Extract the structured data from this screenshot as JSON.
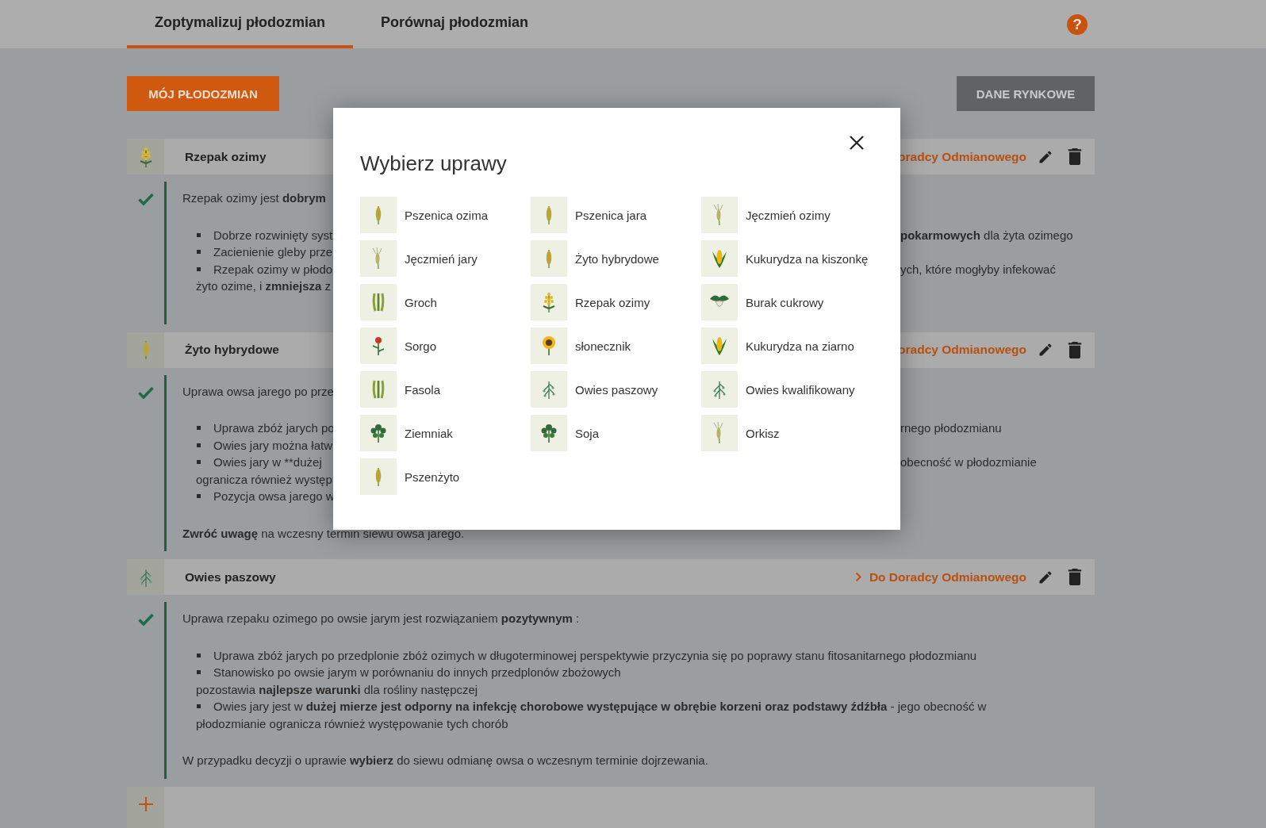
{
  "tabs": [
    {
      "label": "Zoptymalizuj płodozmian",
      "selected": true
    },
    {
      "label": "Porównaj płodozmian",
      "selected": false
    }
  ],
  "help_icon": "?",
  "buttons": {
    "primary": "MÓJ PŁODOZMIAN",
    "secondary": "DANE RYNKOWE"
  },
  "sections": [
    {
      "title": "Rzepak ozimy",
      "kind": "rapeseed",
      "link": "oradcy Odmianowego",
      "positive": true,
      "lines": [
        {
          "kind": "para",
          "left": "Rzepak ozimy jest **dobrym**"
        },
        {
          "kind": "gap"
        },
        {
          "kind": "bullet",
          "left": "Dobrze rozwinięty syst",
          "right": "**pokarmowych** dla żyta ozimego"
        },
        {
          "kind": "bullet",
          "left": "Zacienienie gleby prze"
        },
        {
          "kind": "bullet",
          "left": "Rzepak ozimy w płodo",
          "right": "ych, które mogłyby infekować"
        },
        {
          "kind": "cont",
          "left": "żyto ozime, i **zmniejsza** z"
        },
        {
          "kind": "gap"
        }
      ]
    },
    {
      "title": "Żyto hybrydowe",
      "kind": "grain",
      "link": "oradcy Odmianowego",
      "positive": true,
      "lines": [
        {
          "kind": "para",
          "left": "Uprawa owsa jarego po prze"
        },
        {
          "kind": "gap"
        },
        {
          "kind": "bullet",
          "left": "Uprawa zbóż jarych po",
          "right": "rnego płodozmianu"
        },
        {
          "kind": "bullet",
          "left": "Owies jary można łatw"
        },
        {
          "kind": "bullet",
          "left": "Owies jary w **dużej",
          "right": "obecność w płodozmianie"
        },
        {
          "kind": "cont",
          "left": "ogranicza również występ"
        },
        {
          "kind": "bullet",
          "left": "Pozycja owsa jarego w"
        },
        {
          "kind": "gap"
        },
        {
          "kind": "para",
          "left": "**Zwróć uwagę** na wczesny termin siewu owsa jarego."
        }
      ]
    },
    {
      "title": "Owies paszowy",
      "kind": "oat",
      "link": "Do Doradcy Odmianowego",
      "link_chevron": true,
      "positive": true,
      "lines": [
        {
          "kind": "para",
          "left": "Uprawa rzepaku ozimego po owsie jarym jest rozwiązaniem **pozytywnym** :"
        },
        {
          "kind": "gap"
        },
        {
          "kind": "bullet",
          "left": "Uprawa zbóż jarych po przedplonie zbóż ozimych w długoterminowej perspektywie przyczynia się po poprawy stanu fitosanitarnego płodozmianu"
        },
        {
          "kind": "bullet",
          "left": "Stanowisko po owsie jarym w porównaniu do innych przedplonów zbożowych"
        },
        {
          "kind": "cont",
          "left": "pozostawia **najlepsze warunki** dla rośliny następczej"
        },
        {
          "kind": "bullet",
          "left": "Owies jary jest w **dużej mierze jest odporny na infekcję chorobowe występujące w obrębie korzeni oraz podstawy źdźbła** - jego obecność w"
        },
        {
          "kind": "cont",
          "left": "płodozmianie ogranicza również występowanie tych chorób"
        },
        {
          "kind": "gap"
        },
        {
          "kind": "para",
          "left": "W przypadku decyzji o uprawie **wybierz** do siewu odmianę owsa o wczesnym terminie dojrzewania."
        }
      ]
    }
  ],
  "modal": {
    "title": "Wybierz uprawy",
    "crops": [
      {
        "name": "Pszenica ozima",
        "kind": "grain"
      },
      {
        "name": "Pszenica jara",
        "kind": "grain"
      },
      {
        "name": "Jęczmień ozimy",
        "kind": "barley"
      },
      {
        "name": "Jęczmień jary",
        "kind": "barley"
      },
      {
        "name": "Żyto hybrydowe",
        "kind": "grain"
      },
      {
        "name": "Kukurydza na kiszonkę",
        "kind": "corn"
      },
      {
        "name": "Groch",
        "kind": "pea"
      },
      {
        "name": "Rzepak ozimy",
        "kind": "rapeseed"
      },
      {
        "name": "Burak cukrowy",
        "kind": "beet"
      },
      {
        "name": "Sorgo",
        "kind": "flower"
      },
      {
        "name": "słonecznik",
        "kind": "sunflower"
      },
      {
        "name": "Kukurydza na ziarno",
        "kind": "corn"
      },
      {
        "name": "Fasola",
        "kind": "pea"
      },
      {
        "name": "Owies paszowy",
        "kind": "oat"
      },
      {
        "name": "Owies kwalifikowany",
        "kind": "oat"
      },
      {
        "name": "Ziemniak",
        "kind": "leafy"
      },
      {
        "name": "Soja",
        "kind": "leafy"
      },
      {
        "name": "Orkisz",
        "kind": "barley"
      },
      {
        "name": "Pszenżyto",
        "kind": "grain"
      }
    ]
  }
}
